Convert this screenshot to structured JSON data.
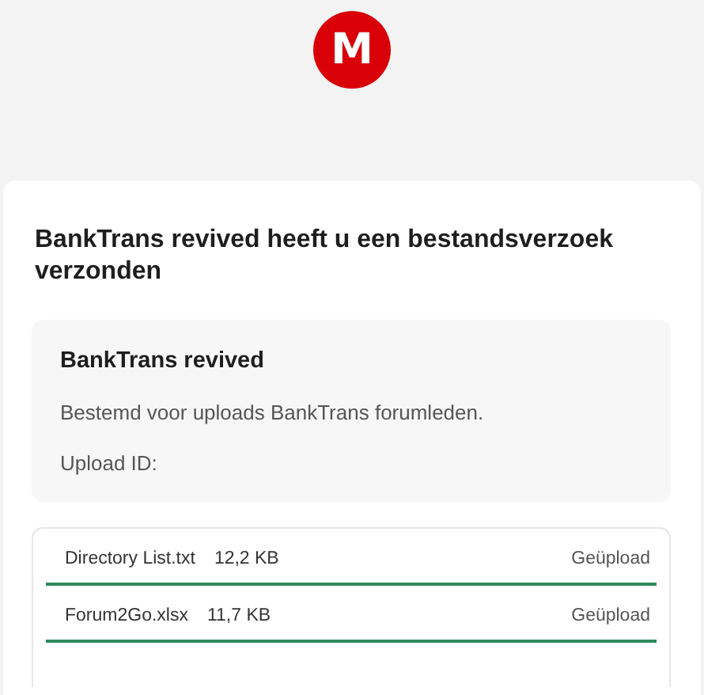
{
  "logo": {
    "letter": "M"
  },
  "request": {
    "title": "BankTrans revived heeft u een bestandsverzoek verzonden"
  },
  "details": {
    "name": "BankTrans revived",
    "description": "Bestemd voor uploads BankTrans forumleden.",
    "upload_id_label": "Upload ID:"
  },
  "files": [
    {
      "name": "Directory List.txt",
      "size": "12,2 KB",
      "status": "Geüpload",
      "level": 1
    },
    {
      "name": "Forum2Go.xlsx",
      "size": "11,7 KB",
      "status": "Geüpload",
      "level": 1
    }
  ]
}
